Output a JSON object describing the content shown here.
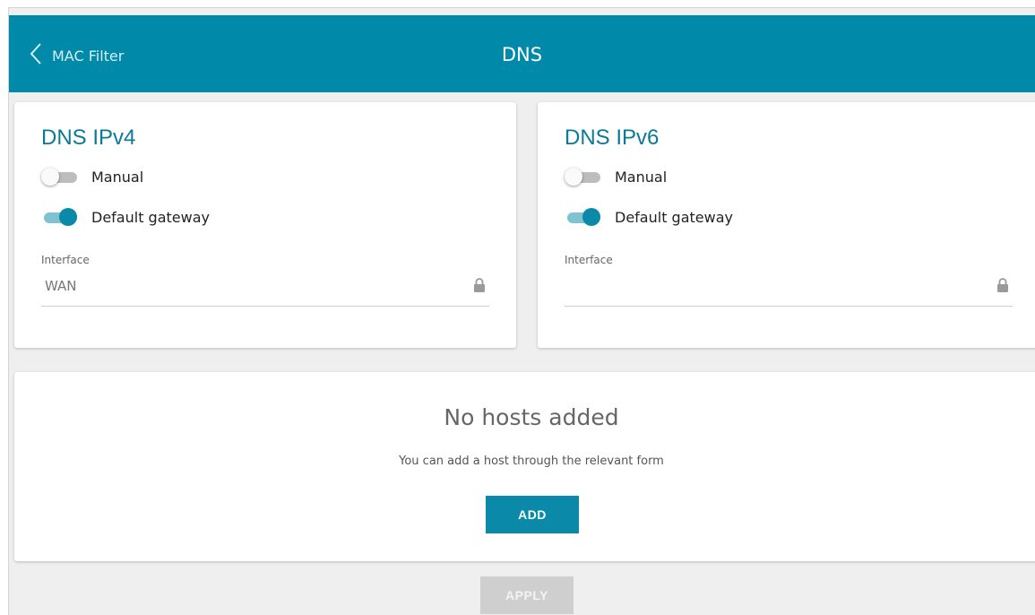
{
  "header": {
    "back_label": "MAC Filter",
    "title": "DNS",
    "color": "#0089a8"
  },
  "ipv4": {
    "title": "DNS IPv4",
    "manual": {
      "label": "Manual",
      "on": false
    },
    "default_gateway": {
      "label": "Default gateway",
      "on": true
    },
    "interface": {
      "label": "Interface",
      "value": "WAN",
      "locked": true
    }
  },
  "ipv6": {
    "title": "DNS IPv6",
    "manual": {
      "label": "Manual",
      "on": false
    },
    "default_gateway": {
      "label": "Default gateway",
      "on": true
    },
    "interface": {
      "label": "Interface",
      "value": "",
      "locked": true
    }
  },
  "hosts": {
    "empty_title": "No hosts added",
    "empty_subtitle": "You can add a host through the relevant form",
    "add_label": "ADD"
  },
  "footer": {
    "apply_label": "APPLY",
    "apply_disabled": true
  },
  "icons": {
    "back": "chevron-left-icon",
    "lock": "lock-icon"
  },
  "colors": {
    "accent": "#0a89a8",
    "title": "#0a7b96",
    "background": "#efefef"
  }
}
